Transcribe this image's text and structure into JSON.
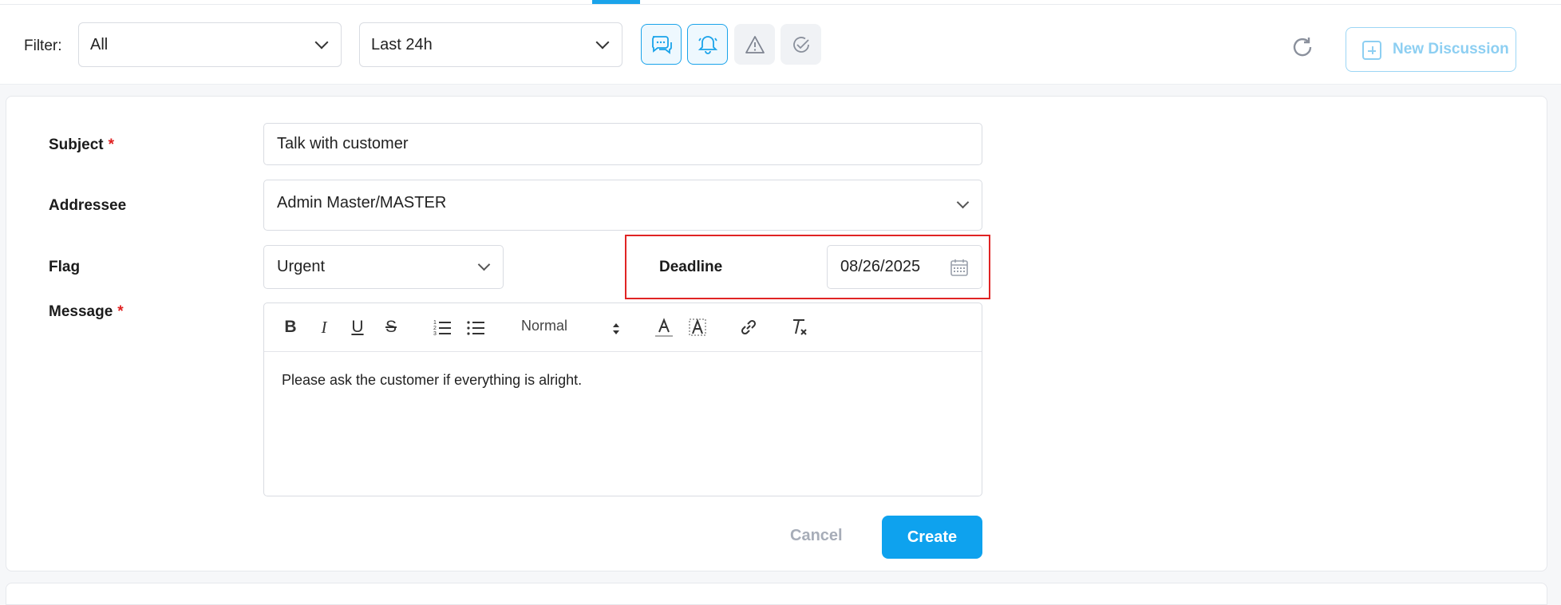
{
  "toolbar": {
    "filter_label": "Filter:",
    "filter_value": "All",
    "period_value": "Last 24h",
    "new_discussion_label": "New Discussion",
    "accent_color": "#1aa3ea"
  },
  "form": {
    "subject_label": "Subject",
    "subject_value": "Talk with customer",
    "addressee_label": "Addressee",
    "addressee_value": "Admin Master/MASTER",
    "flag_label": "Flag",
    "flag_value": "Urgent",
    "deadline_label": "Deadline",
    "deadline_value": "08/26/2025",
    "message_label": "Message",
    "required_mark": "*",
    "format_value": "Normal",
    "message_text": "Please ask the customer if everything is alright.",
    "cancel_label": "Cancel",
    "create_label": "Create",
    "highlight_color": "#e02424"
  }
}
